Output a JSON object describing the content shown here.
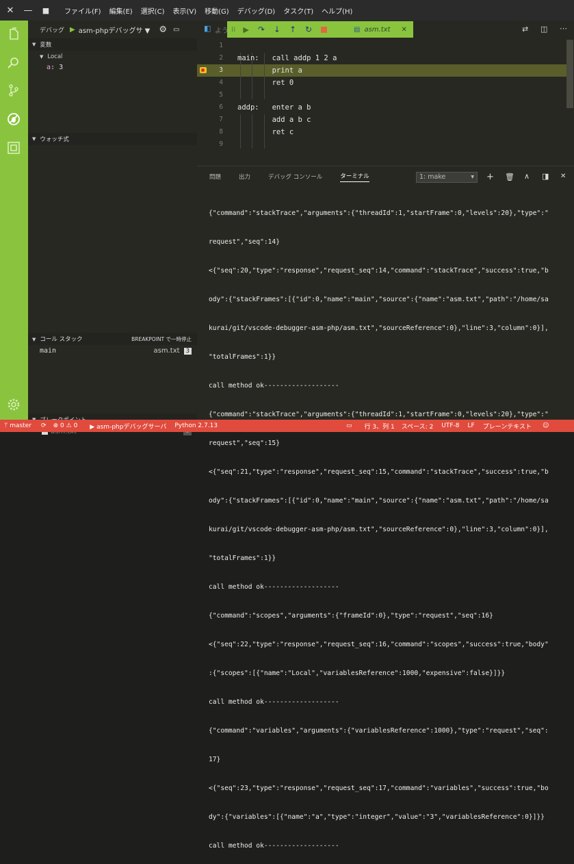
{
  "menu": [
    "ファイル(F)",
    "編集(E)",
    "選択(C)",
    "表示(V)",
    "移動(G)",
    "デバッグ(D)",
    "タスク(T)",
    "ヘルプ(H)"
  ],
  "debug": {
    "label": "デバッグ",
    "config": "asm-phpデバッグサ ▼"
  },
  "variables": {
    "header": "変数",
    "scope": "Local",
    "items": [
      {
        "name": "a",
        "value": "3"
      }
    ]
  },
  "watch": {
    "header": "ウォッチ式"
  },
  "callstack": {
    "header": "コール スタック",
    "status": "BREAKPOINT で一時停止",
    "frame": "main",
    "file": "asm.txt",
    "line": "3"
  },
  "breakpoints": {
    "header": "ブレークポイント",
    "file": "asm.txt",
    "line": "3"
  },
  "editor_tab": {
    "prefix": "よう",
    "file": "asm.txt"
  },
  "code_lines": [
    {
      "n": "1",
      "text": ""
    },
    {
      "n": "2",
      "text": "main:   call addp 1 2 a"
    },
    {
      "n": "3",
      "text": "        print a"
    },
    {
      "n": "4",
      "text": "        ret 0"
    },
    {
      "n": "5",
      "text": ""
    },
    {
      "n": "6",
      "text": "addp:   enter a b"
    },
    {
      "n": "7",
      "text": "        add a b c"
    },
    {
      "n": "8",
      "text": "        ret c"
    },
    {
      "n": "9",
      "text": ""
    }
  ],
  "panel": {
    "tabs": [
      "問題",
      "出力",
      "デバッグ コンソール",
      "ターミナル"
    ],
    "terminal_select": "1: make",
    "terminal_lines": [
      "{\"command\":\"stackTrace\",\"arguments\":{\"threadId\":1,\"startFrame\":0,\"levels\":20},\"type\":\"",
      "request\",\"seq\":14}",
      "<{\"seq\":20,\"type\":\"response\",\"request_seq\":14,\"command\":\"stackTrace\",\"success\":true,\"b",
      "ody\":{\"stackFrames\":[{\"id\":0,\"name\":\"main\",\"source\":{\"name\":\"asm.txt\",\"path\":\"/home/sa",
      "kurai/git/vscode-debugger-asm-php/asm.txt\",\"sourceReference\":0},\"line\":3,\"column\":0}],",
      "\"totalFrames\":1}}",
      "call method ok-------------------",
      "{\"command\":\"stackTrace\",\"arguments\":{\"threadId\":1,\"startFrame\":0,\"levels\":20},\"type\":\"",
      "request\",\"seq\":15}",
      "<{\"seq\":21,\"type\":\"response\",\"request_seq\":15,\"command\":\"stackTrace\",\"success\":true,\"b",
      "ody\":{\"stackFrames\":[{\"id\":0,\"name\":\"main\",\"source\":{\"name\":\"asm.txt\",\"path\":\"/home/sa",
      "kurai/git/vscode-debugger-asm-php/asm.txt\",\"sourceReference\":0},\"line\":3,\"column\":0}],",
      "\"totalFrames\":1}}",
      "call method ok-------------------",
      "{\"command\":\"scopes\",\"arguments\":{\"frameId\":0},\"type\":\"request\",\"seq\":16}",
      "<{\"seq\":22,\"type\":\"response\",\"request_seq\":16,\"command\":\"scopes\",\"success\":true,\"body\"",
      ":{\"scopes\":[{\"name\":\"Local\",\"variablesReference\":1000,\"expensive\":false}]}}",
      "call method ok-------------------",
      "{\"command\":\"variables\",\"arguments\":{\"variablesReference\":1000},\"type\":\"request\",\"seq\":",
      "17}",
      "<{\"seq\":23,\"type\":\"response\",\"request_seq\":17,\"command\":\"variables\",\"success\":true,\"bo",
      "dy\":{\"variables\":[{\"name\":\"a\",\"type\":\"integer\",\"value\":\"3\",\"variablesReference\":0}]}}",
      "call method ok-------------------"
    ]
  },
  "status": {
    "branch": "master",
    "errors": "0",
    "warnings": "0",
    "debug_config": "asm-phpデバッグサーバ",
    "python": "Python 2.7.13",
    "position": "行 3、列 1",
    "spaces": "スペース: 2",
    "encoding": "UTF-8",
    "eol": "LF",
    "language": "プレーンテキスト"
  }
}
